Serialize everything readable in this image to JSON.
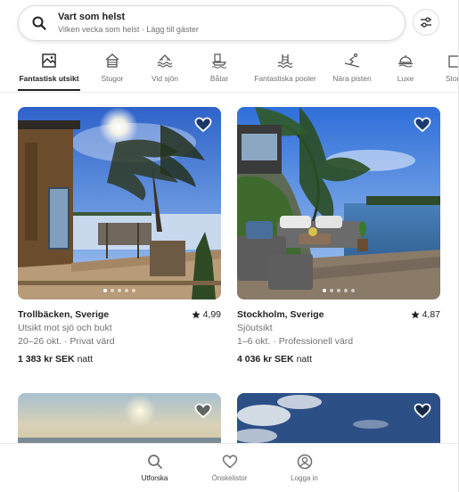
{
  "search": {
    "title": "Vart som helst",
    "subtitle": "Vilken vecka som helst · Lägg till gäster",
    "icon": "search-icon",
    "filter_icon": "filter-icon"
  },
  "categories": [
    {
      "label": "Fantastisk utsikt",
      "icon": "view-icon",
      "active": true
    },
    {
      "label": "Stugor",
      "icon": "cabin-icon"
    },
    {
      "label": "Vid sjön",
      "icon": "lake-icon"
    },
    {
      "label": "Båtar",
      "icon": "boat-icon"
    },
    {
      "label": "Fantastiska pooler",
      "icon": "pool-icon"
    },
    {
      "label": "Nära pisten",
      "icon": "ski-icon"
    },
    {
      "label": "Luxe",
      "icon": "luxe-icon"
    },
    {
      "label": "Stora",
      "icon": "large-icon"
    }
  ],
  "listings": [
    {
      "location": "Trollbäcken, Sverige",
      "rating": "4,99",
      "description": "Utsikt mot sjö och bukt",
      "dates": "20–26 okt. · Privat värd",
      "price": "1 383 kr SEK",
      "price_unit": "natt"
    },
    {
      "location": "Stockholm, Sverige",
      "rating": "4,87",
      "description": "Sjöutsikt",
      "dates": "1–6 okt. · Professionell värd",
      "price": "4 036 kr SEK",
      "price_unit": "natt"
    }
  ],
  "nav": {
    "explore": "Utforska",
    "wishlists": "Önskelistor",
    "login": "Logga in"
  },
  "colors": {
    "text": "#222222",
    "muted": "#717171",
    "border": "#dddddd"
  }
}
